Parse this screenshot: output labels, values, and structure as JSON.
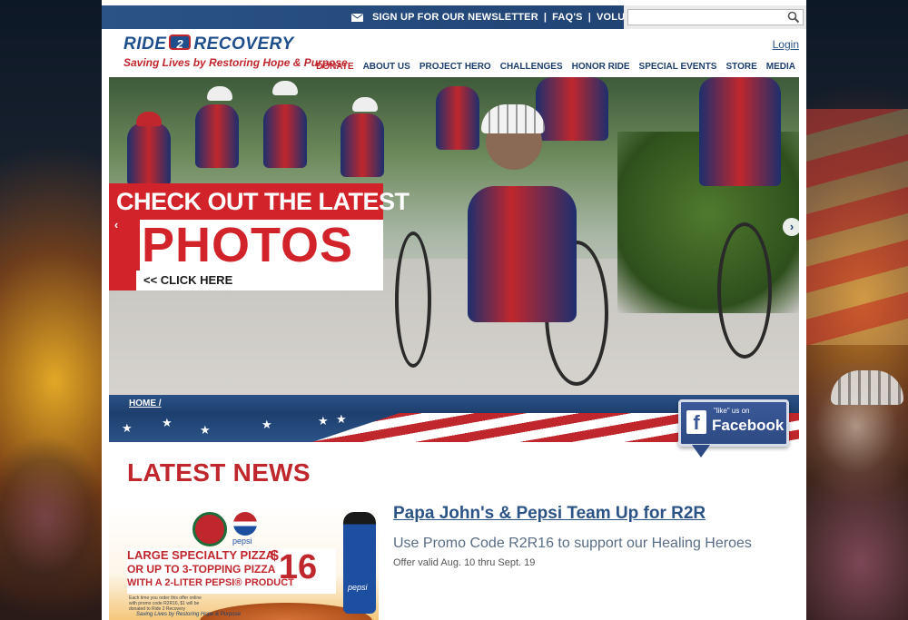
{
  "topbar": {
    "newsletter": "SIGN UP FOR OUR NEWSLETTER",
    "faqs": "FAQ'S",
    "volunteer": "VOLUNTEER",
    "separator": "|",
    "search_placeholder": ""
  },
  "header": {
    "logo_left": "RIDE",
    "logo_badge": "2",
    "logo_right": "RECOVERY",
    "tagline": "Saving Lives by Restoring Hope & Purpose",
    "login": "Login"
  },
  "nav": {
    "items": [
      "DONATE",
      "ABOUT US",
      "PROJECT HERO",
      "CHALLENGES",
      "HONOR RIDE",
      "SPECIAL EVENTS",
      "STORE",
      "MEDIA"
    ]
  },
  "hero": {
    "line1": "CHECK OUT THE LATEST",
    "line2": "PHOTOS",
    "cta": "<< CLICK HERE",
    "prev_arrow": "‹",
    "next_arrow": "›"
  },
  "breadcrumb": {
    "home": "HOME /"
  },
  "facebook": {
    "like_text": "\"like\" us on",
    "name": "Facebook"
  },
  "news": {
    "heading": "LATEST NEWS",
    "item": {
      "title": "Papa John's & Pepsi Team Up for R2R",
      "subtitle": "Use Promo Code R2R16 to support our Healing Heroes",
      "note": "Offer valid Aug. 10 thru Sept. 19"
    },
    "image": {
      "line1": "LARGE SPECIALTY PIZZA",
      "line2": "OR UP TO 3-TOPPING PIZZA",
      "line3": "WITH A 2-LITER PEPSI® PRODUCT",
      "price": "16",
      "currency": "$",
      "pepsi_word": "pepsi",
      "bottle_label": "pepsi",
      "small_print": "Each time you order this offer online with promo code R2R16, $1 will be donated to Ride 2 Recovery",
      "tagline": "Saving Lives by Restoring Hope & Purpose"
    }
  },
  "colors": {
    "brand_blue": "#1d3f6e",
    "brand_red": "#c0272d",
    "facebook_blue": "#3b5998"
  }
}
